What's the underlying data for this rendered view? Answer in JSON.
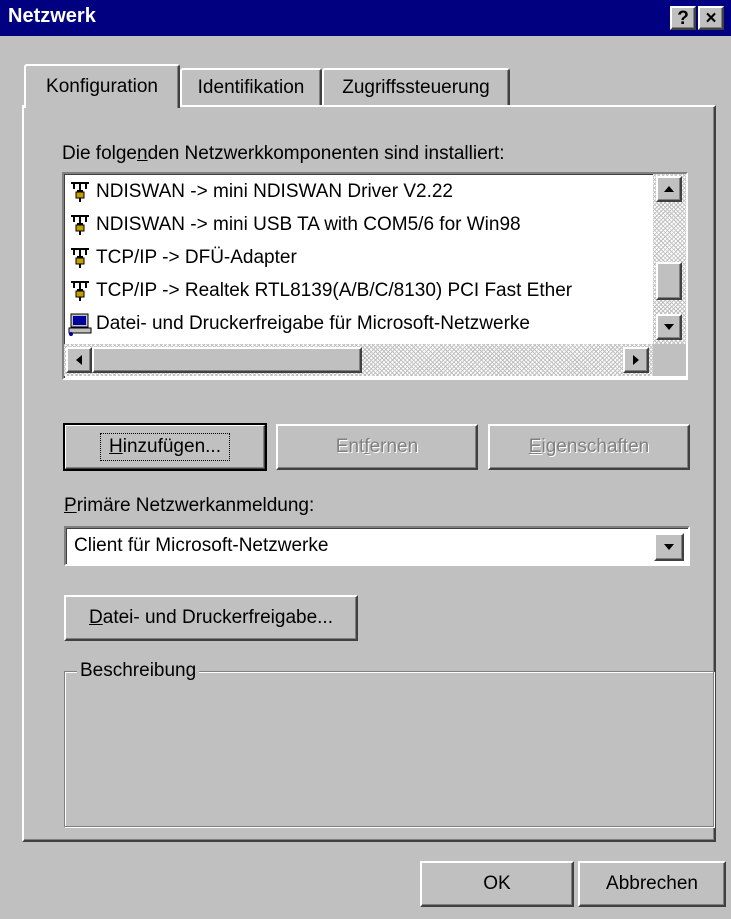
{
  "window": {
    "title": "Netzwerk",
    "help_button": "?",
    "close_button": "×"
  },
  "tabs": [
    {
      "label": "Konfiguration",
      "active": true
    },
    {
      "label": "Identifikation",
      "active": false
    },
    {
      "label": "Zugriffssteuerung",
      "active": false
    }
  ],
  "components": {
    "label_pre": "Die folge",
    "label_accel": "n",
    "label_post": "den Netzwerkkomponenten sind installiert:",
    "items": [
      {
        "text": "NDISWAN -> mini NDISWAN Driver V2.22",
        "icon": "network-protocol-icon"
      },
      {
        "text": "NDISWAN -> mini USB TA with COM5/6 for Win98",
        "icon": "network-protocol-icon"
      },
      {
        "text": "TCP/IP -> DFÜ-Adapter",
        "icon": "network-protocol-icon"
      },
      {
        "text": "TCP/IP -> Realtek RTL8139(A/B/C/8130) PCI Fast Ether",
        "icon": "network-protocol-icon"
      },
      {
        "text": "Datei- und Druckerfreigabe für Microsoft-Netzwerke",
        "icon": "network-service-icon"
      }
    ]
  },
  "buttons": {
    "add_accel": "H",
    "add_rest": "inzufügen...",
    "remove_pre": "Ent",
    "remove_accel": "f",
    "remove_post": "ernen",
    "properties_accel": "E",
    "properties_rest": "igenschaften",
    "file_share_accel": "D",
    "file_share_rest": "atei- und Druckerfreigabe...",
    "ok": "OK",
    "cancel": "Abbrechen"
  },
  "primary_logon": {
    "label_accel": "P",
    "label_rest": "rimäre Netzwerkanmeldung:",
    "selected": "Client für Microsoft-Netzwerke"
  },
  "description": {
    "group_label": "Beschreibung"
  },
  "colors": {
    "titlebar": "#000080",
    "face": "#c0c0c0"
  }
}
